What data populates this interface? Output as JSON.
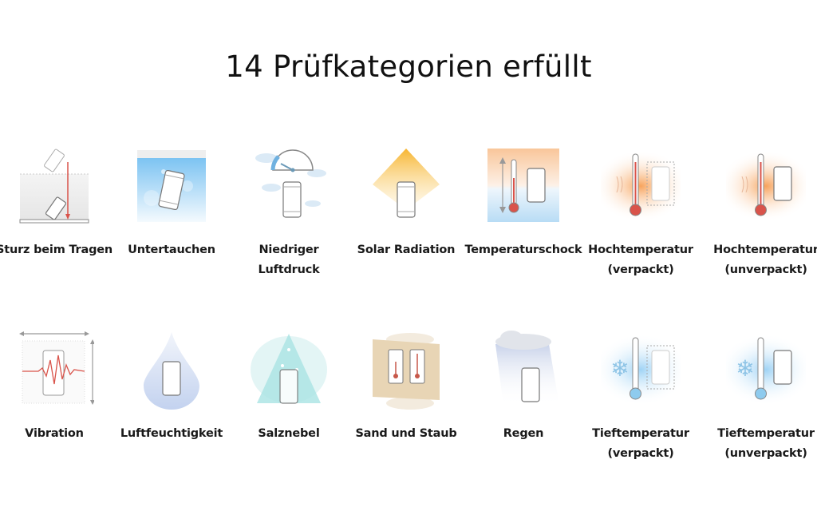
{
  "title": "14 Prüfkategorien erfüllt",
  "categories": [
    {
      "icon": "drop-test-icon",
      "label": [
        "Sturz beim Tragen"
      ]
    },
    {
      "icon": "submersion-icon",
      "label": [
        "Untertauchen"
      ]
    },
    {
      "icon": "low-pressure-icon",
      "label": [
        "Niedriger",
        "Luftdruck"
      ]
    },
    {
      "icon": "solar-radiation-icon",
      "label": [
        "Solar Radiation"
      ]
    },
    {
      "icon": "thermal-shock-icon",
      "label": [
        "Temperaturschock"
      ]
    },
    {
      "icon": "high-temp-packed-icon",
      "label": [
        "Hochtemperatur",
        "(verpackt)"
      ]
    },
    {
      "icon": "high-temp-unpacked-icon",
      "label": [
        "Hochtemperatur",
        "(unverpackt)"
      ]
    },
    {
      "icon": "vibration-icon",
      "label": [
        "Vibration"
      ]
    },
    {
      "icon": "humidity-icon",
      "label": [
        "Luftfeuchtigkeit"
      ]
    },
    {
      "icon": "salt-fog-icon",
      "label": [
        "Salznebel"
      ]
    },
    {
      "icon": "sand-dust-icon",
      "label": [
        "Sand und Staub"
      ]
    },
    {
      "icon": "rain-icon",
      "label": [
        "Regen"
      ]
    },
    {
      "icon": "low-temp-packed-icon",
      "label": [
        "Tieftemperatur",
        "(verpackt)"
      ]
    },
    {
      "icon": "low-temp-unpacked-icon",
      "label": [
        "Tieftemperatur",
        "(unverpackt)"
      ]
    }
  ],
  "colors": {
    "red": "#d9534a",
    "phone_stroke": "#8a8a8a",
    "orange_glow": "#f7a35c",
    "blue_glow": "#9fd3f5",
    "water": "#8fcaf2",
    "sand": "#e8d5b5",
    "salt": "#7fd6d6"
  }
}
